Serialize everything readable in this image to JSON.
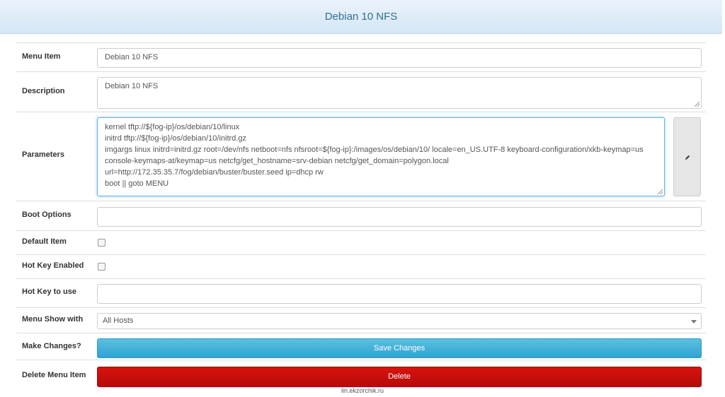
{
  "header": {
    "title": "Debian 10 NFS"
  },
  "fields": {
    "menu_item": {
      "label": "Menu Item",
      "value": "Debian 10 NFS"
    },
    "description": {
      "label": "Description",
      "value": "Debian 10 NFS"
    },
    "parameters": {
      "label": "Parameters",
      "value": "kernel tftp://${fog-ip}/os/debian/10/linux\ninitrd tftp://${fog-ip}/os/debian/10/initrd.gz\nimgargs linux initrd=initrd.gz root=/dev/nfs netboot=nfs nfsroot=${fog-ip}:/images/os/debian/10/ locale=en_US.UTF-8 keyboard-configuration/xkb-keymap=us console-keymaps-at/keymap=us netcfg/get_hostname=srv-debian netcfg/get_domain=polygon.local\nurl=http://172.35.35.7/fog/debian/buster/buster.seed ip=dhcp rw\nboot || goto MENU"
    },
    "boot_options": {
      "label": "Boot Options",
      "value": ""
    },
    "default_item": {
      "label": "Default Item",
      "checked": false
    },
    "hot_key_enabled": {
      "label": "Hot Key Enabled",
      "checked": false
    },
    "hot_key_to_use": {
      "label": "Hot Key to use",
      "value": ""
    },
    "menu_show_with": {
      "label": "Menu Show with",
      "selected": "All Hosts"
    },
    "make_changes": {
      "label": "Make Changes?",
      "button": "Save Changes"
    },
    "delete_menu_item": {
      "label": "Delete Menu Item",
      "button": "Delete"
    }
  },
  "icons": {
    "edit": "pencil-icon",
    "select": "chevron-down-icon"
  },
  "colors": {
    "header_text": "#31708f",
    "save_button": "#31a2d3",
    "delete_button": "#c9100c"
  },
  "watermark": "lin.ekzorchik.ru"
}
